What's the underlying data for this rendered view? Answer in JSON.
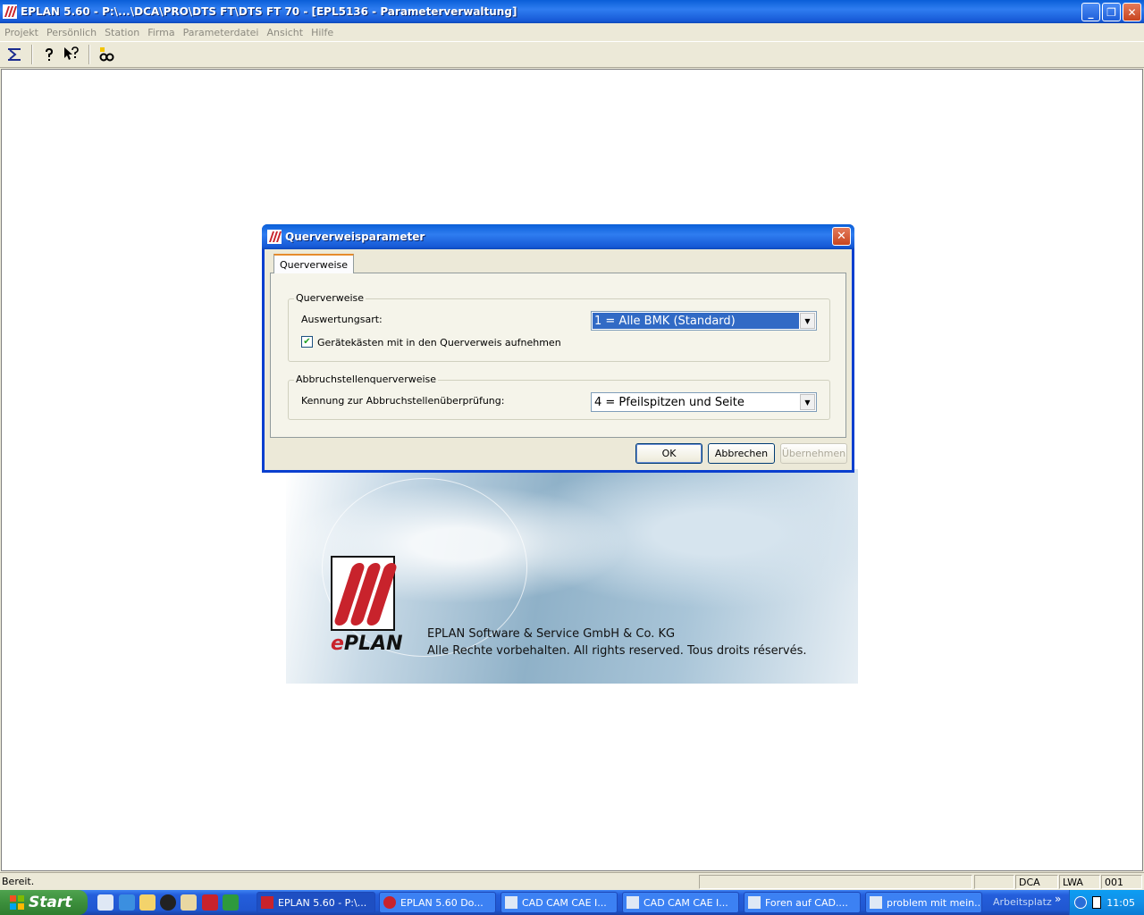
{
  "window": {
    "title": "EPLAN 5.60 - P:\\...\\DCA\\PRO\\DTS FT\\DTS FT 70 - [EPL5136 - Parameterverwaltung]",
    "buttons": {
      "minimize": "_",
      "restore": "❐",
      "close": "✕"
    }
  },
  "menu": {
    "items": [
      "Projekt",
      "Persönlich",
      "Station",
      "Firma",
      "Parameterdatei",
      "Ansicht",
      "Hilfe"
    ]
  },
  "toolbar": {
    "icons": [
      "sigma-icon",
      "help-icon",
      "context-help-icon",
      "search-icon"
    ]
  },
  "splash": {
    "logo_e": "e",
    "logo_plan": "PLAN",
    "line1": "EPLAN Software & Service GmbH & Co. KG",
    "line2": "Alle Rechte vorbehalten. All rights reserved. Tous droits réservés."
  },
  "dialog": {
    "title": "Querverweisparameter",
    "close": "✕",
    "tab": "Querverweise",
    "group1": {
      "label": "Querverweise",
      "auswertungsart_label": "Auswertungsart:",
      "auswertungsart_value": "1 = Alle BMK (Standard)",
      "checkbox_label": "Gerätekästen mit in den Querverweis aufnehmen",
      "checkbox_checked": true
    },
    "group2": {
      "label": "Abbruchstellenquerverweise",
      "kennung_label": "Kennung zur Abbruchstellenüberprüfung:",
      "kennung_value": "4 = Pfeilspitzen und Seite"
    },
    "buttons": {
      "ok": "OK",
      "cancel": "Abbrechen",
      "apply": "Übernehmen"
    }
  },
  "status": {
    "text": "Bereit.",
    "panes": [
      "DCA",
      "LWA",
      "001"
    ]
  },
  "taskbar": {
    "start": "Start",
    "tasks": [
      {
        "label": "EPLAN 5.60 - P:\\...",
        "active": true
      },
      {
        "label": "EPLAN 5.60   Do...",
        "active": false
      },
      {
        "label": "CAD CAM CAE I...",
        "active": false
      },
      {
        "label": "CAD CAM CAE I...",
        "active": false
      },
      {
        "label": "Foren auf CAD....",
        "active": false
      },
      {
        "label": "problem mit mein...",
        "active": false
      }
    ],
    "arbeitsplatz": "Arbeitsplatz",
    "chevron": "»",
    "clock": "11:05"
  },
  "colors": {
    "titlebar": "#0a5fd8",
    "selection": "#316ac5",
    "logo_red": "#c8232c",
    "start_green": "#3c8f3c"
  }
}
